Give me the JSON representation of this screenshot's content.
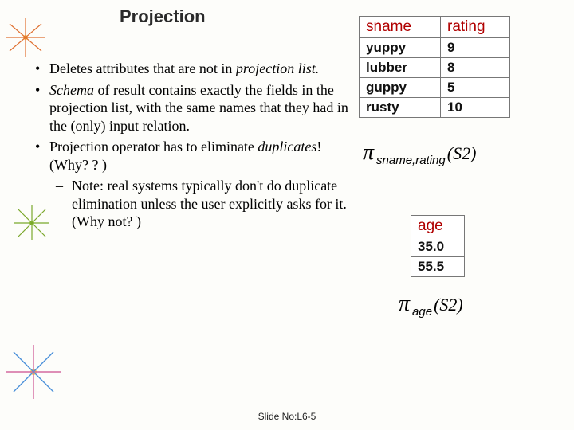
{
  "title": "Projection",
  "bullets": {
    "b1_pre": "Deletes attributes that are not in ",
    "b1_em": "projection list.",
    "b2_em": "Schema",
    "b2_post": " of result contains exactly the fields in the projection list, with the same names that they had in the (only) input relation.",
    "b3_pre": "Projection operator has to eliminate ",
    "b3_em": "duplicates",
    "b3_post": "!  (Why? ? )",
    "note": "Note: real systems typically don't do duplicate elimination unless the user explicitly asks for it.  (Why not? )"
  },
  "table1": {
    "h1": "sname",
    "h2": "rating",
    "r1c1": "yuppy",
    "r1c2": "9",
    "r2c1": "lubber",
    "r2c2": "8",
    "r3c1": "guppy",
    "r3c2": "5",
    "r4c1": "rusty",
    "r4c2": "10"
  },
  "formula1": {
    "sub": "sname,rating",
    "arg": "(S2)"
  },
  "table2": {
    "h1": "age",
    "r1c1": "35.0",
    "r2c1": "55.5"
  },
  "formula2": {
    "sub": "age",
    "arg": "(S2)"
  },
  "footer": "Slide No:L6-5"
}
